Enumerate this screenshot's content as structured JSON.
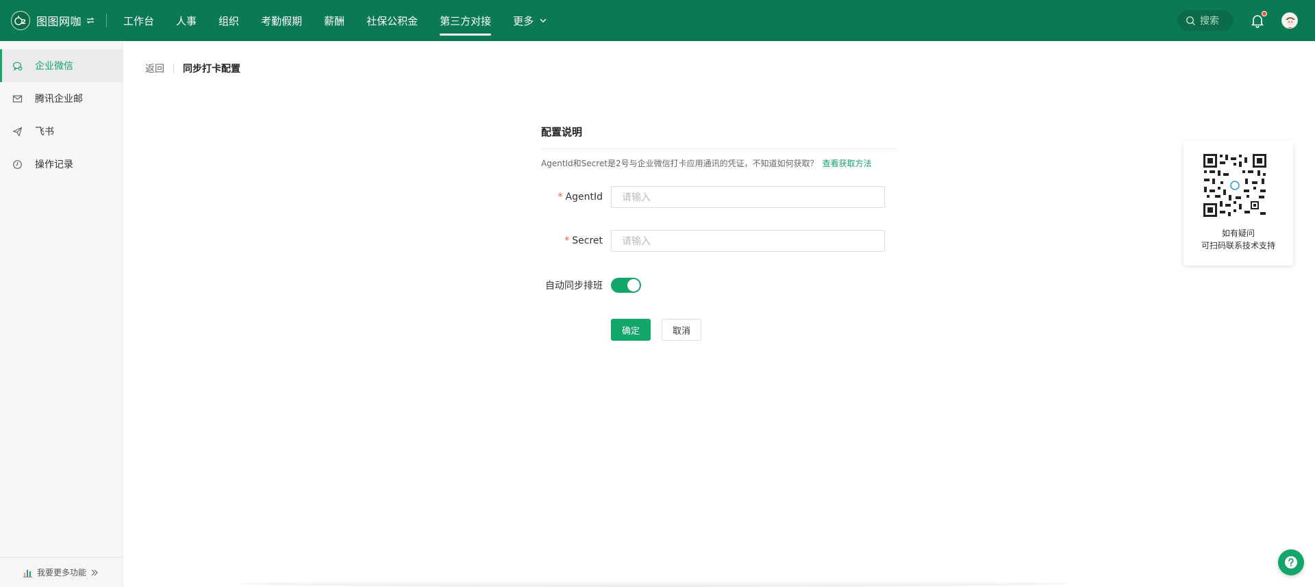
{
  "header": {
    "app_name": "图图网咖",
    "nav": [
      {
        "label": "工作台",
        "active": false
      },
      {
        "label": "人事",
        "active": false
      },
      {
        "label": "组织",
        "active": false
      },
      {
        "label": "考勤假期",
        "active": false
      },
      {
        "label": "薪酬",
        "active": false
      },
      {
        "label": "社保公积金",
        "active": false
      },
      {
        "label": "第三方对接",
        "active": true
      },
      {
        "label": "更多",
        "active": false
      }
    ],
    "search_label": "搜索"
  },
  "sidebar": {
    "items": [
      {
        "label": "企业微信",
        "icon": "chat-icon",
        "active": true
      },
      {
        "label": "腾讯企业邮",
        "icon": "mail-icon",
        "active": false
      },
      {
        "label": "飞书",
        "icon": "send-icon",
        "active": false
      },
      {
        "label": "操作记录",
        "icon": "clock-icon",
        "active": false
      }
    ],
    "footer_label": "我要更多功能"
  },
  "breadcrumb": {
    "back_label": "返回",
    "title": "同步打卡配置"
  },
  "form": {
    "title": "配置说明",
    "description": "AgentId和Secret是2号与企业微信打卡应用通讯的凭证，不知道如何获取？",
    "help_link": "查看获取方法",
    "fields": {
      "agentid": {
        "label": "AgentId",
        "placeholder": "请输入",
        "required": true
      },
      "secret": {
        "label": "Secret",
        "placeholder": "请输入",
        "required": true
      },
      "auto_sync": {
        "label": "自动同步排班",
        "checked": true
      }
    },
    "confirm_label": "确定",
    "cancel_label": "取消"
  },
  "qr_card": {
    "line1": "如有疑问",
    "line2": "可扫码联系技术支持"
  },
  "colors": {
    "brand": "#0b7a52",
    "accent": "#12a66a",
    "required": "#f5533d"
  }
}
